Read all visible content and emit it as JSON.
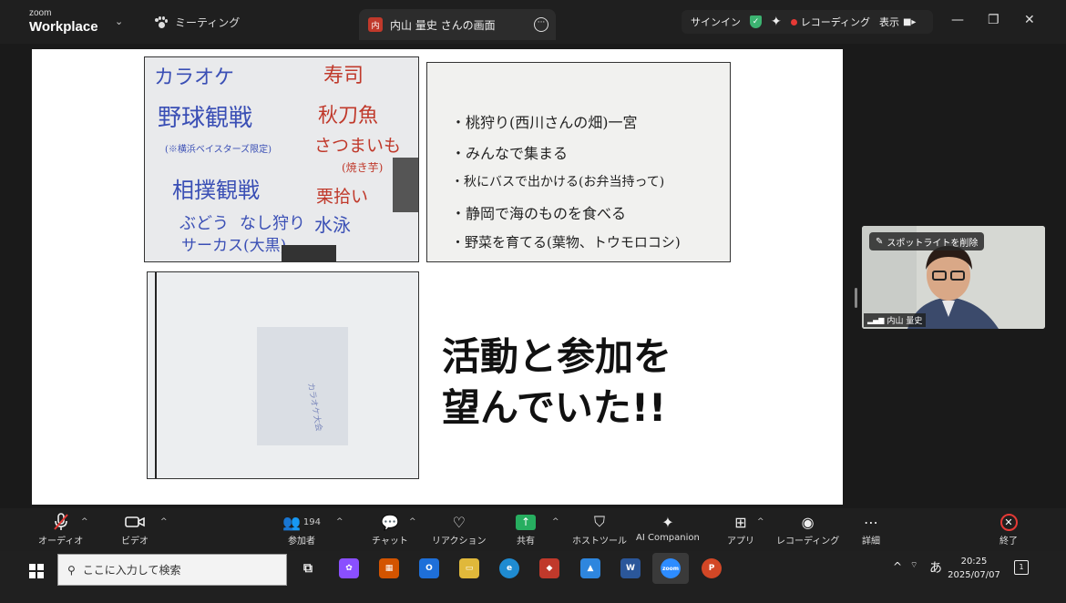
{
  "titlebar": {
    "brand_top": "zoom",
    "brand_main": "Workplace",
    "meeting_tab": "ミーティング",
    "share_tab": "内山 量史 さんの画面",
    "share_avatar": "内",
    "signin": "サインイン",
    "recording": "レコーディング",
    "view": "表示"
  },
  "slide": {
    "photo1_lines": [
      "カラオケ",
      "寿司",
      "野球観戦",
      "秋刀魚",
      "(※横浜ベイスターズ限定)",
      "さつまいも",
      "(焼き芋)",
      "相撲観戦",
      "栗拾い",
      "ぶどう",
      "なし狩り",
      "サーカス(大黒)",
      "水泳"
    ],
    "photo2_lines": [
      "・桃狩り(西川さんの畑)一宮",
      "・みんなで集まる",
      "・秋にバスで出かける(お弁当持って)",
      "・静岡で海のものを食べる",
      "・野菜を育てる(葉物、トウモロコシ)"
    ],
    "photo3_lines": [
      "カラオケ大会"
    ],
    "caption_line1": "活動と参加を",
    "caption_line2": "望んでいた!!"
  },
  "video": {
    "spotlight_label": "スポットライトを削除",
    "name": "内山 量史"
  },
  "toolbar": {
    "audio": "オーディオ",
    "video": "ビデオ",
    "participants": "参加者",
    "participants_count": "194",
    "chat": "チャット",
    "reaction": "リアクション",
    "share": "共有",
    "host_tools": "ホストツール",
    "ai_companion": "AI Companion",
    "apps": "アプリ",
    "recording": "レコーディング",
    "more": "詳細",
    "end": "終了"
  },
  "taskbar": {
    "search_placeholder": "ここに入力して検索",
    "ime": "あ",
    "time": "20:25",
    "date": "2025/07/07",
    "notification_count": "1"
  },
  "colors": {
    "share_green": "#27ae60",
    "record_red": "#e53935",
    "security_green": "#3cb371"
  }
}
